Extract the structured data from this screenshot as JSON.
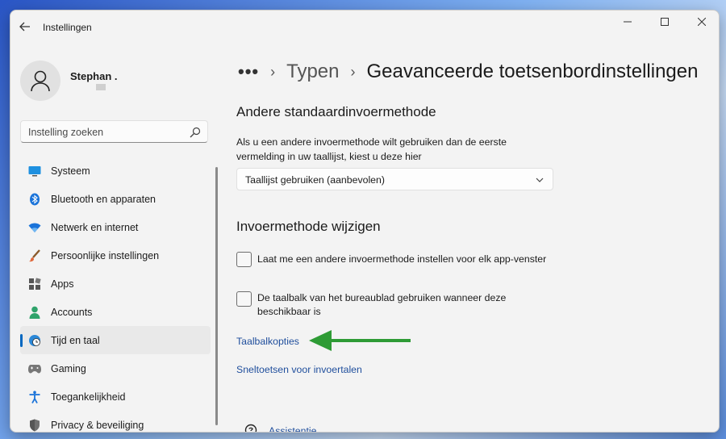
{
  "window": {
    "app_title": "Instellingen",
    "controls": [
      "minimize-icon",
      "maximize-icon",
      "close-icon"
    ]
  },
  "user": {
    "name": "Stephan ."
  },
  "search": {
    "placeholder": "Instelling zoeken"
  },
  "nav": {
    "items": [
      {
        "label": "Systeem",
        "icon": "monitor-icon",
        "selected": false
      },
      {
        "label": "Bluetooth en apparaten",
        "icon": "bluetooth-icon",
        "selected": false
      },
      {
        "label": "Netwerk en internet",
        "icon": "wifi-icon",
        "selected": false
      },
      {
        "label": "Persoonlijke instellingen",
        "icon": "paintbrush-icon",
        "selected": false
      },
      {
        "label": "Apps",
        "icon": "apps-icon",
        "selected": false
      },
      {
        "label": "Accounts",
        "icon": "person-icon",
        "selected": false
      },
      {
        "label": "Tijd en taal",
        "icon": "globe-clock-icon",
        "selected": true
      },
      {
        "label": "Gaming",
        "icon": "gamepad-icon",
        "selected": false
      },
      {
        "label": "Toegankelijkheid",
        "icon": "accessibility-icon",
        "selected": false
      },
      {
        "label": "Privacy & beveiliging",
        "icon": "shield-icon",
        "selected": false
      }
    ]
  },
  "breadcrumb": {
    "dots": "•••",
    "parent": "Typen",
    "current": "Geavanceerde toetsenbordinstellingen"
  },
  "section1": {
    "heading": "Andere standaardinvoermethode",
    "description_line1": "Als u een andere invoermethode wilt gebruiken dan de eerste",
    "description_line2": "vermelding in uw taallijst, kiest u deze hier",
    "dropdown_value": "Taallijst gebruiken (aanbevolen)"
  },
  "section2": {
    "heading": "Invoermethode wijzigen",
    "checkbox1_label": "Laat me een andere invoermethode instellen voor elk app-venster",
    "checkbox1_checked": false,
    "checkbox2_line1": "De taalbalk van het bureaublad gebruiken wanneer deze",
    "checkbox2_line2": "beschikbaar is",
    "checkbox2_checked": false
  },
  "links": {
    "taalbalk": "Taalbalkopties",
    "sneltoetsen": "Sneltoetsen voor invoertalen"
  },
  "footer": {
    "help_label": "Assistentie"
  },
  "colors": {
    "accent": "#0067c0",
    "link": "#1f4e9c",
    "arrow": "#2e9b35"
  }
}
